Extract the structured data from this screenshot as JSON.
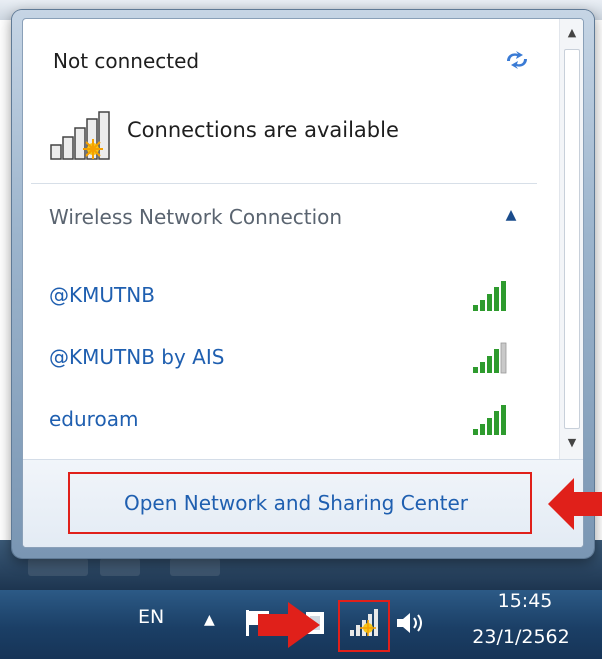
{
  "flyout": {
    "status_title": "Not connected",
    "available_text": "Connections are available",
    "section_header": "Wireless Network Connection",
    "networks": [
      {
        "name": "@KMUTNB",
        "signal": "full",
        "icon": "signal-bars-icon"
      },
      {
        "name": "@KMUTNB by AIS",
        "signal": "partial",
        "icon": "signal-bars-icon"
      },
      {
        "name": "eduroam",
        "signal": "full",
        "icon": "signal-bars-icon"
      }
    ],
    "footer_link": "Open Network and Sharing Center",
    "icons": {
      "refresh": "refresh-icon",
      "collapse": "chevron-up-icon",
      "scroll_up": "scroll-up-arrow-icon",
      "scroll_down": "scroll-down-arrow-icon"
    }
  },
  "taskbar": {
    "language": "EN",
    "time": "15:45",
    "date": "23/1/2562",
    "icons": [
      "show-hidden-icons-chevron",
      "action-center-flag-icon",
      "display-icon",
      "network-status-icon",
      "volume-icon"
    ]
  },
  "colors": {
    "link_blue": "#1f5fb0",
    "signal_green": "#2e9b2e",
    "highlight_red": "#e0201a",
    "taskbar_blue": "#1b3f66"
  }
}
